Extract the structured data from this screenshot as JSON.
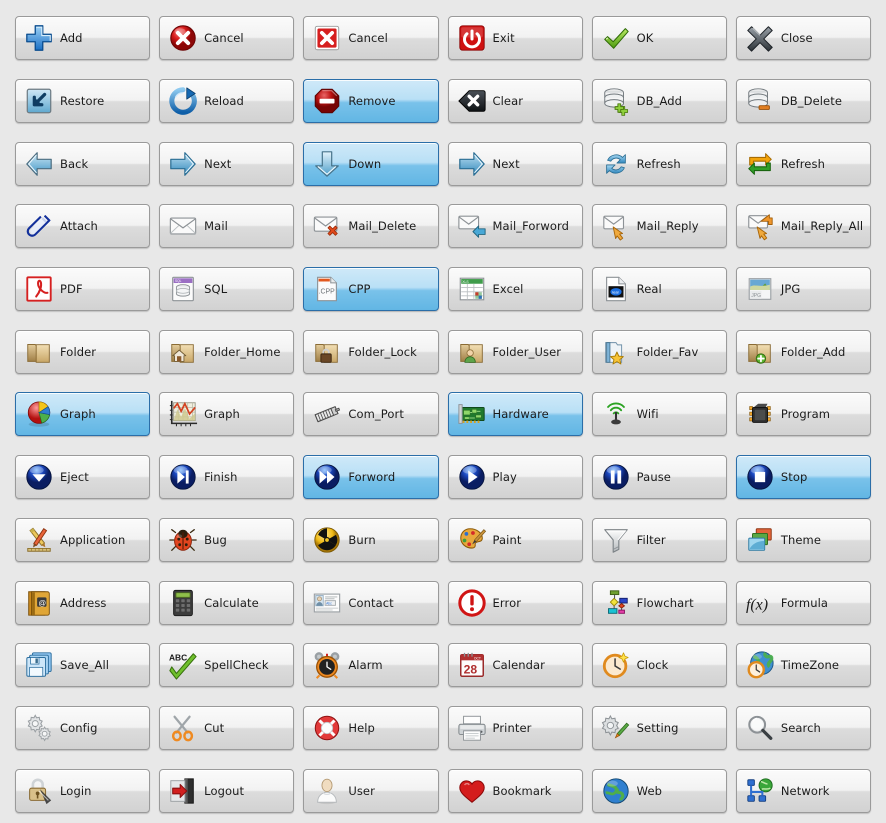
{
  "window": {
    "background_color": "#e8e8e8",
    "button_face_top": "#fbfbfb",
    "button_face_bottom": "#d2d2d2",
    "button_border": "#9a9a9a",
    "selected_top": "#cfe9f8",
    "selected_bottom": "#62b6e4",
    "selected_border": "#2b6ea8",
    "label_color": "#1b1b1b",
    "columns": 6,
    "rows": 13
  },
  "buttons": [
    {
      "label": "Add",
      "icon": "plus-icon",
      "selected": false
    },
    {
      "label": "Cancel",
      "icon": "cancel-circle-icon",
      "selected": false
    },
    {
      "label": "Cancel",
      "icon": "cancel-square-icon",
      "selected": false
    },
    {
      "label": "Exit",
      "icon": "power-icon",
      "selected": false
    },
    {
      "label": "OK",
      "icon": "check-icon",
      "selected": false
    },
    {
      "label": "Close",
      "icon": "close-x-icon",
      "selected": false
    },
    {
      "label": "Restore",
      "icon": "restore-icon",
      "selected": false
    },
    {
      "label": "Reload",
      "icon": "reload-icon",
      "selected": false
    },
    {
      "label": "Remove",
      "icon": "remove-stop-icon",
      "selected": true
    },
    {
      "label": "Clear",
      "icon": "clear-icon",
      "selected": false
    },
    {
      "label": "DB_Add",
      "icon": "database-add-icon",
      "selected": false
    },
    {
      "label": "DB_Delete",
      "icon": "database-delete-icon",
      "selected": false
    },
    {
      "label": "Back",
      "icon": "arrow-left-icon",
      "selected": false
    },
    {
      "label": "Next",
      "icon": "arrow-right-icon",
      "selected": false
    },
    {
      "label": "Down",
      "icon": "arrow-down-icon",
      "selected": true
    },
    {
      "label": "Next",
      "icon": "arrow-right-icon",
      "selected": false
    },
    {
      "label": "Refresh",
      "icon": "refresh-circular-icon",
      "selected": false
    },
    {
      "label": "Refresh",
      "icon": "refresh-loop-icon",
      "selected": false
    },
    {
      "label": "Attach",
      "icon": "paperclip-icon",
      "selected": false
    },
    {
      "label": "Mail",
      "icon": "mail-icon",
      "selected": false
    },
    {
      "label": "Mail_Delete",
      "icon": "mail-delete-icon",
      "selected": false
    },
    {
      "label": "Mail_Forword",
      "icon": "mail-forward-icon",
      "selected": false
    },
    {
      "label": "Mail_Reply",
      "icon": "mail-reply-icon",
      "selected": false
    },
    {
      "label": "Mail_Reply_All",
      "icon": "mail-reply-all-icon",
      "selected": false
    },
    {
      "label": "PDF",
      "icon": "pdf-icon",
      "selected": false
    },
    {
      "label": "SQL",
      "icon": "sql-document-icon",
      "selected": false
    },
    {
      "label": "CPP",
      "icon": "cpp-file-icon",
      "selected": true
    },
    {
      "label": "Excel",
      "icon": "excel-icon",
      "selected": false
    },
    {
      "label": "Real",
      "icon": "real-media-icon",
      "selected": false
    },
    {
      "label": "JPG",
      "icon": "jpg-image-icon",
      "selected": false
    },
    {
      "label": "Folder",
      "icon": "folder-icon",
      "selected": false
    },
    {
      "label": "Folder_Home",
      "icon": "folder-home-icon",
      "selected": false
    },
    {
      "label": "Folder_Lock",
      "icon": "folder-lock-icon",
      "selected": false
    },
    {
      "label": "Folder_User",
      "icon": "folder-user-icon",
      "selected": false
    },
    {
      "label": "Folder_Fav",
      "icon": "folder-favorite-icon",
      "selected": false
    },
    {
      "label": "Folder_Add",
      "icon": "folder-add-icon",
      "selected": false
    },
    {
      "label": "Graph",
      "icon": "pie-chart-icon",
      "selected": true
    },
    {
      "label": "Graph",
      "icon": "line-chart-icon",
      "selected": false
    },
    {
      "label": "Com_Port",
      "icon": "serial-port-icon",
      "selected": false
    },
    {
      "label": "Hardware",
      "icon": "hardware-card-icon",
      "selected": true
    },
    {
      "label": "Wifi",
      "icon": "wifi-icon",
      "selected": false
    },
    {
      "label": "Program",
      "icon": "chip-icon",
      "selected": false
    },
    {
      "label": "Eject",
      "icon": "eject-icon",
      "selected": false
    },
    {
      "label": "Finish",
      "icon": "finish-icon",
      "selected": false
    },
    {
      "label": "Forword",
      "icon": "forward-icon",
      "selected": true
    },
    {
      "label": "Play",
      "icon": "play-icon",
      "selected": false
    },
    {
      "label": "Pause",
      "icon": "pause-icon",
      "selected": false
    },
    {
      "label": "Stop",
      "icon": "stop-icon",
      "selected": true
    },
    {
      "label": "Application",
      "icon": "application-tools-icon",
      "selected": false
    },
    {
      "label": "Bug",
      "icon": "bug-icon",
      "selected": false
    },
    {
      "label": "Burn",
      "icon": "burn-icon",
      "selected": false
    },
    {
      "label": "Paint",
      "icon": "paint-palette-icon",
      "selected": false
    },
    {
      "label": "Filter",
      "icon": "funnel-filter-icon",
      "selected": false
    },
    {
      "label": "Theme",
      "icon": "theme-icon",
      "selected": false
    },
    {
      "label": "Address",
      "icon": "address-book-icon",
      "selected": false
    },
    {
      "label": "Calculate",
      "icon": "calculator-icon",
      "selected": false
    },
    {
      "label": "Contact",
      "icon": "contact-card-icon",
      "selected": false
    },
    {
      "label": "Error",
      "icon": "error-icon",
      "selected": false
    },
    {
      "label": "Flowchart",
      "icon": "flowchart-icon",
      "selected": false
    },
    {
      "label": "Formula",
      "icon": "formula-fx-icon",
      "selected": false
    },
    {
      "label": "Save_All",
      "icon": "save-all-icon",
      "selected": false
    },
    {
      "label": "SpellCheck",
      "icon": "spellcheck-icon",
      "selected": false
    },
    {
      "label": "Alarm",
      "icon": "alarm-clock-icon",
      "selected": false
    },
    {
      "label": "Calendar",
      "icon": "calendar-icon",
      "selected": false
    },
    {
      "label": "Clock",
      "icon": "clock-icon",
      "selected": false
    },
    {
      "label": "TimeZone",
      "icon": "timezone-icon",
      "selected": false
    },
    {
      "label": "Config",
      "icon": "gears-icon",
      "selected": false
    },
    {
      "label": "Cut",
      "icon": "scissors-icon",
      "selected": false
    },
    {
      "label": "Help",
      "icon": "lifering-help-icon",
      "selected": false
    },
    {
      "label": "Printer",
      "icon": "printer-icon",
      "selected": false
    },
    {
      "label": "Setting",
      "icon": "setting-tools-icon",
      "selected": false
    },
    {
      "label": "Search",
      "icon": "search-icon",
      "selected": false
    },
    {
      "label": "Login",
      "icon": "login-lock-icon",
      "selected": false
    },
    {
      "label": "Logout",
      "icon": "logout-icon",
      "selected": false
    },
    {
      "label": "User",
      "icon": "user-icon",
      "selected": false
    },
    {
      "label": "Bookmark",
      "icon": "heart-bookmark-icon",
      "selected": false
    },
    {
      "label": "Web",
      "icon": "globe-web-icon",
      "selected": false
    },
    {
      "label": "Network",
      "icon": "network-icon",
      "selected": false
    }
  ]
}
